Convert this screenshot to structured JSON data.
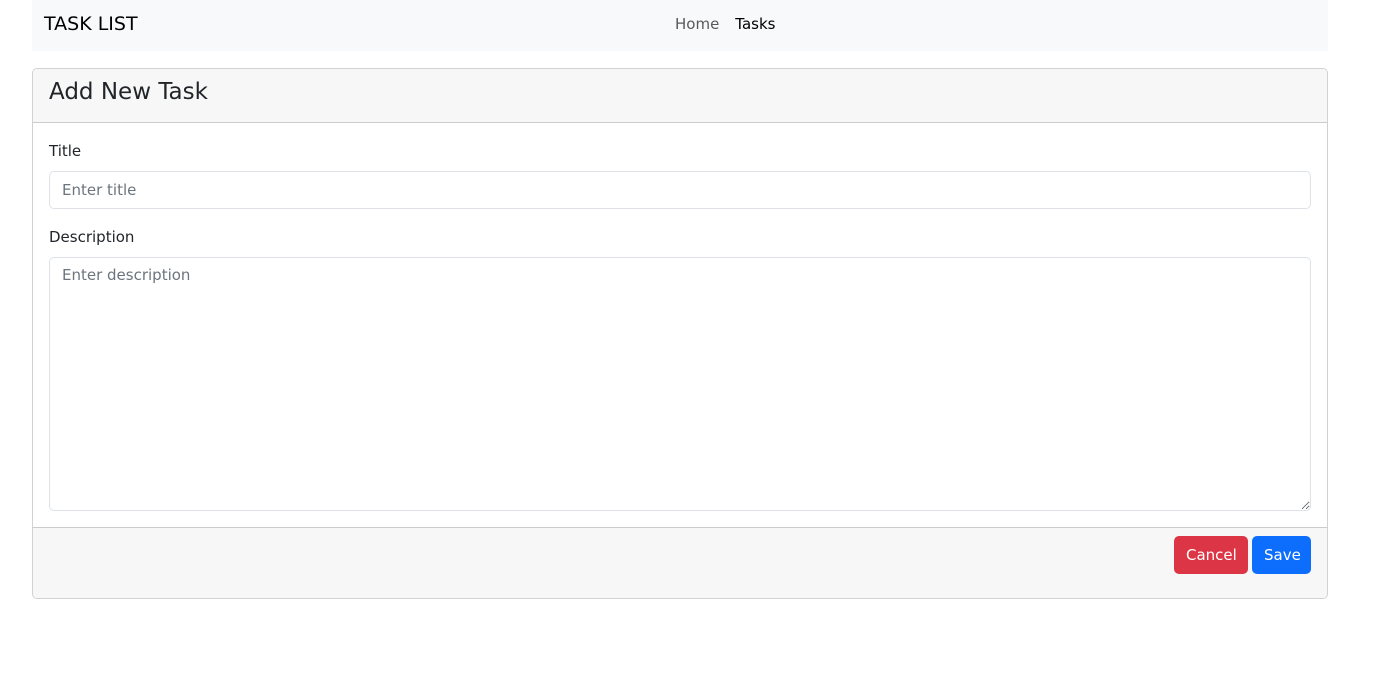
{
  "navbar": {
    "brand": "TASK LIST",
    "links": [
      {
        "label": "Home",
        "active": false
      },
      {
        "label": "Tasks",
        "active": true
      }
    ]
  },
  "card": {
    "title": "Add New Task",
    "fields": {
      "title": {
        "label": "Title",
        "value": "",
        "placeholder": "Enter title"
      },
      "description": {
        "label": "Description",
        "value": "",
        "placeholder": "Enter description"
      }
    },
    "buttons": {
      "cancel": "Cancel",
      "save": "Save"
    }
  },
  "colors": {
    "danger": "#dc3545",
    "primary": "#0d6efd",
    "navbar_bg": "#f8f9fa",
    "card_section_bg": "#f7f7f7"
  }
}
